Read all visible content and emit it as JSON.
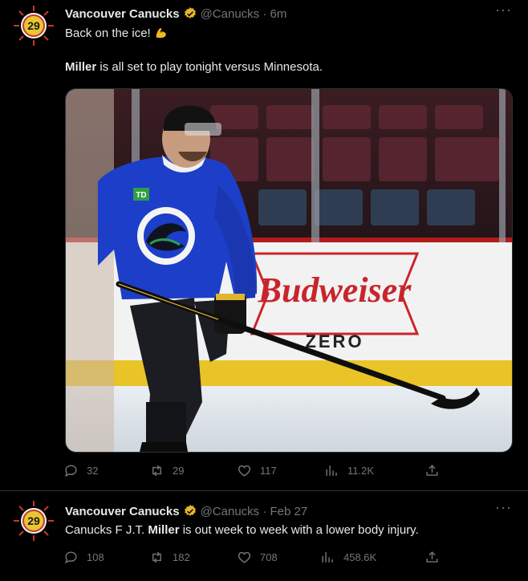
{
  "colors": {
    "background": "#000000",
    "text": "#e7e9ea",
    "muted": "#71767b",
    "verified": "#e8b628",
    "border": "#2f3336"
  },
  "tweet1": {
    "name": "Vancouver Canucks",
    "handle": "@Canucks · 6m",
    "line1": "Back on the ice!",
    "line1_emoji": "flexed-biceps-icon",
    "line2_bold": "Miller",
    "line2_rest": " is all set to play tonight versus Minnesota.",
    "media": {
      "sign_brand": "Budweiser",
      "sign_sub": "ZERO",
      "jersey_patch": "TD",
      "jersey_crest": "VANCOUVER CANUCKS"
    },
    "stats": {
      "replies": "32",
      "retweets": "29",
      "likes": "117",
      "views": "11.2K"
    }
  },
  "tweet2": {
    "name": "Vancouver Canucks",
    "handle": "@Canucks · Feb 27",
    "text_prefix": "Canucks F J.T. ",
    "text_bold": "Miller",
    "text_rest": " is out week to week with a lower body injury.",
    "stats": {
      "replies": "108",
      "retweets": "182",
      "likes": "708",
      "views": "458.6K"
    }
  },
  "avatar_badge": "29",
  "more_glyph": "···"
}
